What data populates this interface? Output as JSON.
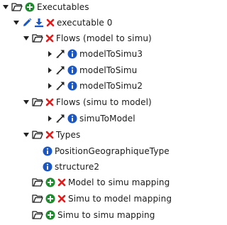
{
  "tree": {
    "root": {
      "label": "Executables"
    },
    "executable": {
      "label": "executable 0"
    },
    "flows_model_to_simu": {
      "label": "Flows (model to simu)",
      "items": [
        {
          "label": "modelToSimu3"
        },
        {
          "label": "modelToSimu"
        },
        {
          "label": "modelToSimu2"
        }
      ]
    },
    "flows_simu_to_model": {
      "label": "Flows (simu to model)",
      "items": [
        {
          "label": "simuToModel"
        }
      ]
    },
    "types": {
      "label": "Types",
      "items": [
        {
          "label": "PositionGeographiqueType"
        },
        {
          "label": "structure2"
        }
      ]
    },
    "mappings": [
      {
        "label": "Model to simu mapping"
      },
      {
        "label": "Simu to model mapping"
      },
      {
        "label": "Simu to simu mapping"
      }
    ]
  },
  "colors": {
    "add": "#1f8a2e",
    "remove": "#e21b1b",
    "info": "#1a56c4",
    "edit": "#1a56c4"
  },
  "icons": {
    "folder": "folder-open-icon",
    "add": "plus-circle-icon",
    "remove": "x-icon",
    "info": "info-circle-icon",
    "edit": "pencil-icon",
    "download": "download-icon",
    "flow": "arrow-diagonal-icon",
    "expanded": "caret-down-icon",
    "collapsed": "caret-right-icon"
  }
}
